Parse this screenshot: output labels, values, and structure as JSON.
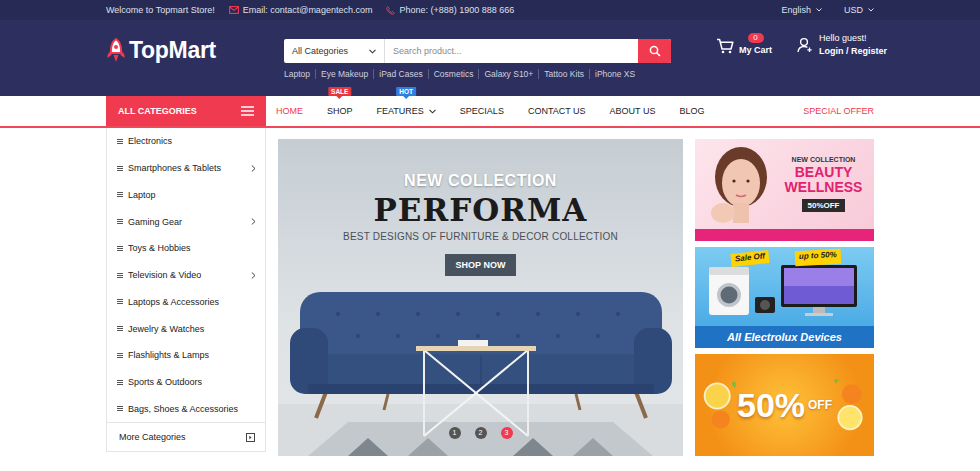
{
  "topbar": {
    "welcome": "Welcome to Topmart Store!",
    "email": "Email: contact@magentech.com",
    "phone": "Phone: (+888) 1900 888 666",
    "language": "English",
    "currency": "USD"
  },
  "logo": {
    "text": "TopMart"
  },
  "search": {
    "category": "All Categories",
    "placeholder": "Search product...",
    "tags": [
      "Laptop",
      "Eye Makeup",
      "iPad Cases",
      "Cosmetics",
      "Galaxy S10+",
      "Tattoo Kits",
      "iPhone XS"
    ]
  },
  "cart": {
    "count": "0",
    "label": "My Cart"
  },
  "account": {
    "greeting": "Hello guest!",
    "link": "Login / Register"
  },
  "nav": {
    "categories_button": "ALL CATEGORIES",
    "items": [
      {
        "label": "HOME",
        "selected": true
      },
      {
        "label": "SHOP",
        "selected": false,
        "badge": "SALE",
        "badge_color": "#e8363f"
      },
      {
        "label": "FEATURES",
        "selected": false,
        "badge": "HOT",
        "badge_color": "#2f7fe0",
        "dropdown": true
      },
      {
        "label": "SPECIALS",
        "selected": false
      },
      {
        "label": "CONTACT US",
        "selected": false
      },
      {
        "label": "ABOUT US",
        "selected": false
      },
      {
        "label": "BLOG",
        "selected": false
      }
    ],
    "special_offer": "SPECIAL OFFER"
  },
  "sidebar": {
    "items": [
      {
        "label": "Electronics",
        "has_submenu": false
      },
      {
        "label": "Smartphones & Tablets",
        "has_submenu": true
      },
      {
        "label": "Laptop",
        "has_submenu": false
      },
      {
        "label": "Gaming Gear",
        "has_submenu": true
      },
      {
        "label": "Toys & Hobbies",
        "has_submenu": false
      },
      {
        "label": "Television & Video",
        "has_submenu": true
      },
      {
        "label": "Laptops & Accessories",
        "has_submenu": false
      },
      {
        "label": "Jewelry & Watches",
        "has_submenu": false
      },
      {
        "label": "Flashlights & Lamps",
        "has_submenu": false
      },
      {
        "label": "Sports & Outdoors",
        "has_submenu": false
      },
      {
        "label": "Bags, Shoes & Accessories",
        "has_submenu": false
      }
    ],
    "more": "More Categories"
  },
  "slider": {
    "eyebrow": "NEW COLLECTION",
    "title": "PERFORMA",
    "subtitle": "BEST DESIGNS OF FURNITURE & DECOR COLLECTION",
    "button": "SHOP NOW",
    "dots": [
      {
        "label": "1",
        "selected": false
      },
      {
        "label": "2",
        "selected": false
      },
      {
        "label": "3",
        "selected": true
      }
    ]
  },
  "banners": [
    {
      "kind": "beauty",
      "tag": "NEW COLLECTION",
      "title": "BEAUTY WELLNESS",
      "discount": "50%OFF"
    },
    {
      "kind": "devices",
      "tag": "Sale Off",
      "title": "All Electrolux Devices",
      "discount": "up to 50%"
    },
    {
      "kind": "fruit",
      "title": "50%",
      "discount": "OFF"
    }
  ]
}
